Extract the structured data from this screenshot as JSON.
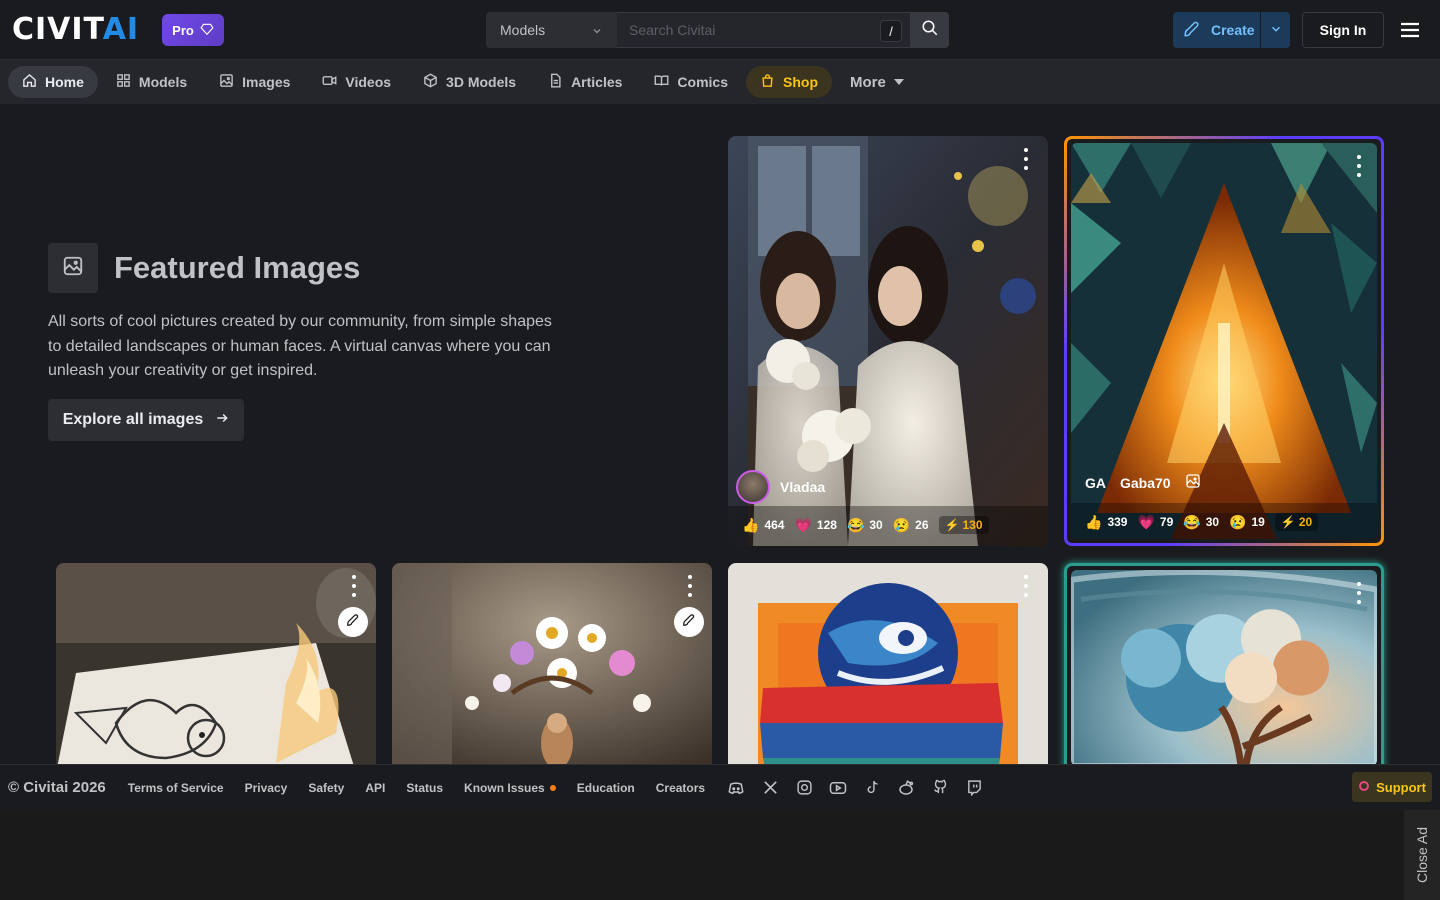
{
  "header": {
    "logo_main": "CIVIT",
    "logo_accent": "AI",
    "pro_label": "Pro",
    "search_scope": "Models",
    "search_placeholder": "Search Civitai",
    "search_shortcut": "/",
    "create_label": "Create",
    "signin_label": "Sign In"
  },
  "nav": [
    {
      "label": "Home",
      "icon": "home-icon"
    },
    {
      "label": "Models",
      "icon": "grid-icon"
    },
    {
      "label": "Images",
      "icon": "image-icon"
    },
    {
      "label": "Videos",
      "icon": "video-icon"
    },
    {
      "label": "3D Models",
      "icon": "cube-icon"
    },
    {
      "label": "Articles",
      "icon": "document-icon"
    },
    {
      "label": "Comics",
      "icon": "book-icon"
    },
    {
      "label": "Shop",
      "icon": "shopping-bag-icon"
    },
    {
      "label": "More",
      "icon": "caret-down-icon"
    }
  ],
  "hero": {
    "title": "Featured Images",
    "description": "All sorts of cool pictures created by our community, from simple shapes to detailed landscapes or human faces. A virtual canvas where you can unleash your creativity or get inspired.",
    "button_label": "Explore all images"
  },
  "cards": {
    "vladaa": {
      "username": "Vladaa",
      "likes": "464",
      "hearts": "128",
      "laughs": "30",
      "cries": "26",
      "buzz": "130"
    },
    "gaba": {
      "initials": "GA",
      "username": "Gaba70",
      "likes": "339",
      "hearts": "79",
      "laughs": "30",
      "cries": "19",
      "buzz": "20"
    }
  },
  "footer": {
    "copyright": "© Civitai 2026",
    "links": [
      "Terms of Service",
      "Privacy",
      "Safety",
      "API",
      "Status",
      "Known Issues",
      "Education",
      "Creators"
    ],
    "social_icons": [
      "discord-icon",
      "x-icon",
      "instagram-icon",
      "youtube-icon",
      "tiktok-icon",
      "reddit-icon",
      "github-icon",
      "twitch-icon"
    ],
    "support_label": "Support"
  },
  "ad": {
    "close_label": "Close Ad"
  },
  "colors": {
    "background": "#1a1b1e",
    "nav_background": "#25262b",
    "accent_blue": "#228be6",
    "shop_yellow": "#fcc419",
    "pro_purple": "#7048e8"
  }
}
